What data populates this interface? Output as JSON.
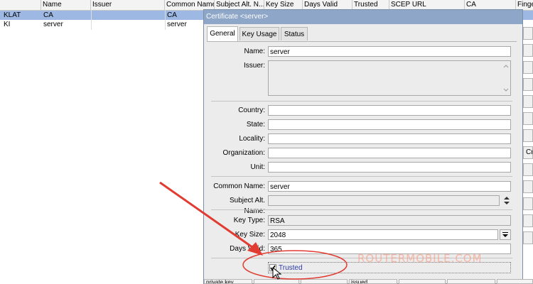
{
  "table": {
    "headers": [
      "Name",
      "Issuer",
      "Common Name",
      "Subject Alt. N...",
      "Key Size",
      "Days Valid",
      "Trusted",
      "SCEP URL",
      "CA",
      "Finge"
    ],
    "rows": [
      {
        "flags": "KLAT",
        "name": "CA",
        "issuer": "",
        "common_name": "CA",
        "selected": true
      },
      {
        "flags": "KI",
        "name": "server",
        "issuer": "",
        "common_name": "server",
        "selected": false
      }
    ]
  },
  "dialog": {
    "title": "Certificate <server>",
    "tabs": [
      "General",
      "Key Usage",
      "Status"
    ],
    "active_tab": "General",
    "fields": {
      "name": {
        "label": "Name:",
        "value": "server"
      },
      "issuer": {
        "label": "Issuer:",
        "value": ""
      },
      "country": {
        "label": "Country:",
        "value": ""
      },
      "state": {
        "label": "State:",
        "value": ""
      },
      "locality": {
        "label": "Locality:",
        "value": ""
      },
      "organization": {
        "label": "Organization:",
        "value": ""
      },
      "unit": {
        "label": "Unit:",
        "value": ""
      },
      "common_name": {
        "label": "Common Name:",
        "value": "server"
      },
      "subject_alt_name": {
        "label": "Subject Alt. Name:",
        "value": ""
      },
      "key_type": {
        "label": "Key Type:",
        "value": "RSA"
      },
      "key_size": {
        "label": "Key Size:",
        "value": "2048"
      },
      "days_valid": {
        "label": "Days Valid:",
        "value": "365"
      }
    },
    "trusted": {
      "label": "Trusted",
      "checked": true
    }
  },
  "side_buttons": {
    "partial_label": "Cr"
  },
  "status_bar": {
    "items": [
      "private key",
      "",
      "",
      "issued",
      "",
      "",
      ""
    ]
  },
  "watermark": "ROUTERMOBILE.COM",
  "colors": {
    "selection": "#9db9e3",
    "titlebar": "#8ea6c8",
    "annotation": "#e03c31"
  }
}
